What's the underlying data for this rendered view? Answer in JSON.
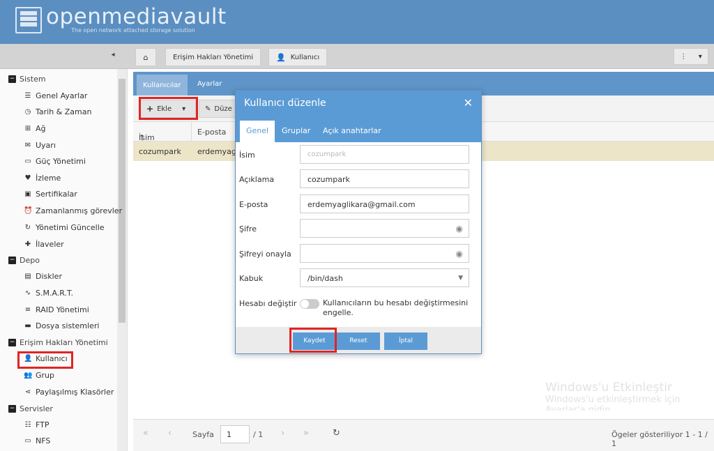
{
  "app": {
    "logo_text": "openmediavault",
    "logo_subtitle": "The open network attached storage solution"
  },
  "toolbar": {
    "collapse_glyph": "◂",
    "breadcrumb": [
      "Erişim Hakları Yönetimi",
      "Kullanıcı"
    ]
  },
  "sidebar": {
    "items": [
      {
        "label": "Sistem",
        "icon": "minus-box-icon",
        "group": true
      },
      {
        "label": "Genel Ayarlar",
        "icon": "sliders-icon"
      },
      {
        "label": "Tarih & Zaman",
        "icon": "clock-icon"
      },
      {
        "label": "Ağ",
        "icon": "network-icon"
      },
      {
        "label": "Uyarı",
        "icon": "envelope-icon"
      },
      {
        "label": "Güç Yönetimi",
        "icon": "battery-icon"
      },
      {
        "label": "İzleme",
        "icon": "heartbeat-icon"
      },
      {
        "label": "Sertifikalar",
        "icon": "certificate-icon"
      },
      {
        "label": "Zamanlanmış görevler",
        "icon": "alarm-clock-icon"
      },
      {
        "label": "Yönetimi Güncelle",
        "icon": "refresh-icon"
      },
      {
        "label": "İlaveler",
        "icon": "puzzle-icon"
      },
      {
        "label": "Depo",
        "icon": "minus-box-icon",
        "group": true
      },
      {
        "label": "Diskler",
        "icon": "disk-icon"
      },
      {
        "label": "S.M.A.R.T.",
        "icon": "pulse-icon"
      },
      {
        "label": "RAID Yönetimi",
        "icon": "database-icon"
      },
      {
        "label": "Dosya sistemleri",
        "icon": "folder-icon"
      },
      {
        "label": "Erişim Hakları Yönetimi",
        "icon": "minus-box-icon",
        "group": true
      },
      {
        "label": "Kullanıcı",
        "icon": "user-icon"
      },
      {
        "label": "Grup",
        "icon": "users-icon"
      },
      {
        "label": "Paylaşılmış Klasörler",
        "icon": "share-icon"
      },
      {
        "label": "Servisler",
        "icon": "minus-box-icon",
        "group": true
      },
      {
        "label": "FTP",
        "icon": "server-icon"
      },
      {
        "label": "NFS",
        "icon": "monitor-icon"
      }
    ]
  },
  "main": {
    "tabs": [
      "Kullanıcılar",
      "Ayarlar"
    ],
    "add_label": "Ekle",
    "edit_label": "Düze",
    "columns": [
      "İsim",
      "E-posta"
    ],
    "row": {
      "name": "cozumpark",
      "email": "erdemyag"
    },
    "pager": {
      "page_label": "Sayfa",
      "page_value": "1",
      "page_total": "/ 1",
      "status": "Ögeler gösteriliyor 1 - 1 / 1"
    }
  },
  "modal": {
    "title": "Kullanıcı düzenle",
    "tabs": [
      "Genel",
      "Gruplar",
      "Açık anahtarlar"
    ],
    "fields": {
      "name_label": "İsim",
      "name_placeholder": "cozumpark",
      "desc_label": "Açıklama",
      "desc_value": "cozumpark",
      "email_label": "E-posta",
      "email_value": "erdemyaglikara@gmail.com",
      "password_label": "Şifre",
      "confirm_label": "Şifreyi onayla",
      "shell_label": "Kabuk",
      "shell_value": "/bin/dash",
      "disallow_label": "Hesabı değiştir",
      "disallow_text": "Kullanıcıların bu hesabı değiştirmesini engelle."
    },
    "buttons": {
      "save": "Kaydet",
      "reset": "Reset",
      "cancel": "İptal"
    }
  },
  "watermark": {
    "line1": "Windows'u Etkinleştir",
    "line2": "Windows'u etkinleştirmek için",
    "line3": "Ayarlar'a gidin."
  }
}
